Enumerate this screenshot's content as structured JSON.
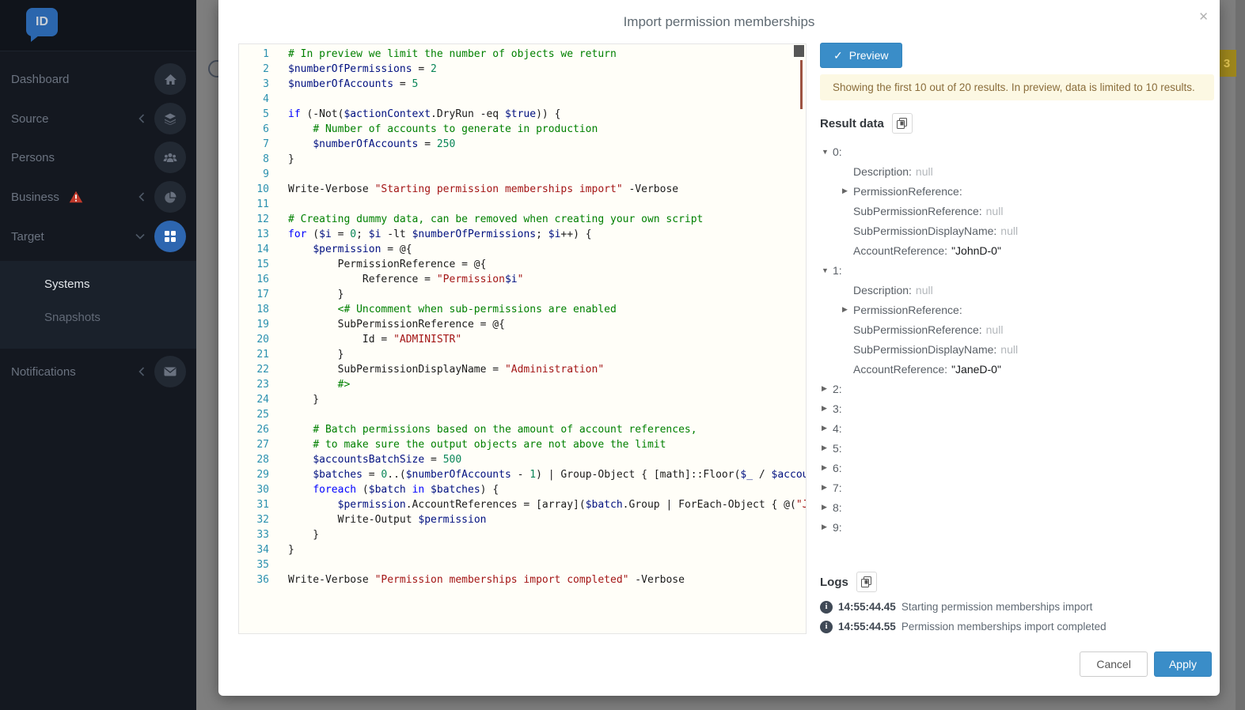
{
  "app": {
    "backdrop_badge": "3"
  },
  "colors": {
    "accent_blue": "#3a8dc8",
    "warning_bg": "#fcf8e3",
    "warning_text": "#8a6d3b",
    "alert_red": "#c0392b",
    "target_active_blue": "#2d66b0",
    "line_number": "#2b91af"
  },
  "sidebar": {
    "logo_text": "ID",
    "items": [
      {
        "label": "Dashboard",
        "icon": "home",
        "chevron": null,
        "alert": false,
        "active": false
      },
      {
        "label": "Source",
        "icon": "layers",
        "chevron": "left",
        "alert": false,
        "active": false
      },
      {
        "label": "Persons",
        "icon": "users",
        "chevron": null,
        "alert": false,
        "active": false
      },
      {
        "label": "Business",
        "icon": "chart",
        "chevron": "left",
        "alert": true,
        "active": false
      },
      {
        "label": "Target",
        "icon": "grid",
        "chevron": "down",
        "alert": false,
        "active": true
      }
    ],
    "submenu": [
      {
        "label": "Systems",
        "active": true
      },
      {
        "label": "Snapshots",
        "active": false
      }
    ],
    "bottom_items": [
      {
        "label": "Notifications",
        "icon": "envelope",
        "chevron": "left",
        "alert": false,
        "active": false
      }
    ]
  },
  "modal": {
    "title": "Import permission memberships",
    "close_icon": "✕"
  },
  "preview": {
    "button_label": "Preview",
    "check_icon": "✓",
    "notice": "Showing the first 10 out of 20 results. In preview, data is limited to 10 results."
  },
  "editor": {
    "lines": [
      {
        "n": 1,
        "t": [
          [
            "c",
            "# In preview we limit the number of objects we return"
          ]
        ]
      },
      {
        "n": 2,
        "t": [
          [
            "v",
            "$numberOfPermissions"
          ],
          [
            "p",
            " = "
          ],
          [
            "n",
            "2"
          ]
        ]
      },
      {
        "n": 3,
        "t": [
          [
            "v",
            "$numberOfAccounts"
          ],
          [
            "p",
            " = "
          ],
          [
            "n",
            "5"
          ]
        ]
      },
      {
        "n": 4,
        "t": []
      },
      {
        "n": 5,
        "t": [
          [
            "k",
            "if"
          ],
          [
            "p",
            " (-Not("
          ],
          [
            "v",
            "$actionContext"
          ],
          [
            "p",
            ".DryRun -eq "
          ],
          [
            "v",
            "$true"
          ],
          [
            "p",
            ")) {"
          ]
        ]
      },
      {
        "n": 6,
        "t": [
          [
            "p",
            "    "
          ],
          [
            "c",
            "# Number of accounts to generate in production"
          ]
        ]
      },
      {
        "n": 7,
        "t": [
          [
            "p",
            "    "
          ],
          [
            "v",
            "$numberOfAccounts"
          ],
          [
            "p",
            " = "
          ],
          [
            "n",
            "250"
          ]
        ]
      },
      {
        "n": 8,
        "t": [
          [
            "p",
            "}"
          ]
        ]
      },
      {
        "n": 9,
        "t": []
      },
      {
        "n": 10,
        "t": [
          [
            "p",
            "Write-Verbose "
          ],
          [
            "s",
            "\"Starting permission memberships import\""
          ],
          [
            "p",
            " -Verbose"
          ]
        ]
      },
      {
        "n": 11,
        "t": []
      },
      {
        "n": 12,
        "t": [
          [
            "c",
            "# Creating dummy data, can be removed when creating your own script"
          ]
        ]
      },
      {
        "n": 13,
        "t": [
          [
            "k",
            "for"
          ],
          [
            "p",
            " ("
          ],
          [
            "v",
            "$i"
          ],
          [
            "p",
            " = "
          ],
          [
            "n",
            "0"
          ],
          [
            "p",
            "; "
          ],
          [
            "v",
            "$i"
          ],
          [
            "p",
            " -lt "
          ],
          [
            "v",
            "$numberOfPermissions"
          ],
          [
            "p",
            "; "
          ],
          [
            "v",
            "$i"
          ],
          [
            "p",
            "++) {"
          ]
        ]
      },
      {
        "n": 14,
        "t": [
          [
            "p",
            "    "
          ],
          [
            "v",
            "$permission"
          ],
          [
            "p",
            " = @{"
          ]
        ]
      },
      {
        "n": 15,
        "t": [
          [
            "p",
            "        PermissionReference = @{"
          ]
        ]
      },
      {
        "n": 16,
        "t": [
          [
            "p",
            "            Reference = "
          ],
          [
            "s",
            "\"Permission"
          ],
          [
            "v",
            "$i"
          ],
          [
            "s",
            "\""
          ]
        ]
      },
      {
        "n": 17,
        "t": [
          [
            "p",
            "        }"
          ]
        ]
      },
      {
        "n": 18,
        "t": [
          [
            "p",
            "        "
          ],
          [
            "c",
            "<# Uncomment when sub-permissions are enabled"
          ]
        ]
      },
      {
        "n": 19,
        "t": [
          [
            "p",
            "        SubPermissionReference = @{"
          ]
        ]
      },
      {
        "n": 20,
        "t": [
          [
            "p",
            "            Id = "
          ],
          [
            "s",
            "\"ADMINISTR\""
          ]
        ]
      },
      {
        "n": 21,
        "t": [
          [
            "p",
            "        }"
          ]
        ]
      },
      {
        "n": 22,
        "t": [
          [
            "p",
            "        SubPermissionDisplayName = "
          ],
          [
            "s",
            "\"Administration\""
          ]
        ]
      },
      {
        "n": 23,
        "t": [
          [
            "p",
            "        "
          ],
          [
            "c",
            "#>"
          ]
        ]
      },
      {
        "n": 24,
        "t": [
          [
            "p",
            "    }"
          ]
        ]
      },
      {
        "n": 25,
        "t": []
      },
      {
        "n": 26,
        "t": [
          [
            "p",
            "    "
          ],
          [
            "c",
            "# Batch permissions based on the amount of account references,"
          ]
        ]
      },
      {
        "n": 27,
        "t": [
          [
            "p",
            "    "
          ],
          [
            "c",
            "# to make sure the output objects are not above the limit"
          ]
        ]
      },
      {
        "n": 28,
        "t": [
          [
            "p",
            "    "
          ],
          [
            "v",
            "$accountsBatchSize"
          ],
          [
            "p",
            " = "
          ],
          [
            "n",
            "500"
          ]
        ]
      },
      {
        "n": 29,
        "t": [
          [
            "p",
            "    "
          ],
          [
            "v",
            "$batches"
          ],
          [
            "p",
            " = "
          ],
          [
            "n",
            "0"
          ],
          [
            "p",
            "..("
          ],
          [
            "v",
            "$numberOfAccounts"
          ],
          [
            "p",
            " - "
          ],
          [
            "n",
            "1"
          ],
          [
            "p",
            ") | Group-Object { [math]::Floor("
          ],
          [
            "v",
            "$_"
          ],
          [
            "p",
            " / "
          ],
          [
            "v",
            "$accoun"
          ]
        ]
      },
      {
        "n": 30,
        "t": [
          [
            "p",
            "    "
          ],
          [
            "k",
            "foreach"
          ],
          [
            "p",
            " ("
          ],
          [
            "v",
            "$batch"
          ],
          [
            "p",
            " "
          ],
          [
            "k",
            "in"
          ],
          [
            "p",
            " "
          ],
          [
            "v",
            "$batches"
          ],
          [
            "p",
            ") {"
          ]
        ]
      },
      {
        "n": 31,
        "t": [
          [
            "p",
            "        "
          ],
          [
            "v",
            "$permission"
          ],
          [
            "p",
            ".AccountReferences = [array]("
          ],
          [
            "v",
            "$batch"
          ],
          [
            "p",
            ".Group | ForEach-Object { @("
          ],
          [
            "s",
            "\"Joh"
          ]
        ]
      },
      {
        "n": 32,
        "t": [
          [
            "p",
            "        Write-Output "
          ],
          [
            "v",
            "$permission"
          ]
        ]
      },
      {
        "n": 33,
        "t": [
          [
            "p",
            "    }"
          ]
        ]
      },
      {
        "n": 34,
        "t": [
          [
            "p",
            "}"
          ]
        ]
      },
      {
        "n": 35,
        "t": []
      },
      {
        "n": 36,
        "t": [
          [
            "p",
            "Write-Verbose "
          ],
          [
            "s",
            "\"Permission memberships import completed\""
          ],
          [
            "p",
            " -Verbose"
          ]
        ]
      }
    ]
  },
  "result_data": {
    "heading": "Result data",
    "items": [
      {
        "key": "0",
        "expanded": true,
        "children": [
          {
            "label": "Description",
            "value": "null",
            "kind": "null",
            "expandable": false
          },
          {
            "label": "PermissionReference",
            "value": "",
            "kind": "object",
            "expandable": true
          },
          {
            "label": "SubPermissionReference",
            "value": "null",
            "kind": "null",
            "expandable": false
          },
          {
            "label": "SubPermissionDisplayName",
            "value": "null",
            "kind": "null",
            "expandable": false
          },
          {
            "label": "AccountReference",
            "value": "\"JohnD-0\"",
            "kind": "string",
            "expandable": false
          }
        ]
      },
      {
        "key": "1",
        "expanded": true,
        "children": [
          {
            "label": "Description",
            "value": "null",
            "kind": "null",
            "expandable": false
          },
          {
            "label": "PermissionReference",
            "value": "",
            "kind": "object",
            "expandable": true
          },
          {
            "label": "SubPermissionReference",
            "value": "null",
            "kind": "null",
            "expandable": false
          },
          {
            "label": "SubPermissionDisplayName",
            "value": "null",
            "kind": "null",
            "expandable": false
          },
          {
            "label": "AccountReference",
            "value": "\"JaneD-0\"",
            "kind": "string",
            "expandable": false
          }
        ]
      },
      {
        "key": "2",
        "expanded": false,
        "children": []
      },
      {
        "key": "3",
        "expanded": false,
        "children": []
      },
      {
        "key": "4",
        "expanded": false,
        "children": []
      },
      {
        "key": "5",
        "expanded": false,
        "children": []
      },
      {
        "key": "6",
        "expanded": false,
        "children": []
      },
      {
        "key": "7",
        "expanded": false,
        "children": []
      },
      {
        "key": "8",
        "expanded": false,
        "children": []
      },
      {
        "key": "9",
        "expanded": false,
        "children": []
      }
    ]
  },
  "logs": {
    "heading": "Logs",
    "entries": [
      {
        "time": "14:55:44.45",
        "message": "Starting permission memberships import"
      },
      {
        "time": "14:55:44.55",
        "message": "Permission memberships import completed"
      }
    ]
  },
  "footer": {
    "cancel_label": "Cancel",
    "apply_label": "Apply"
  }
}
